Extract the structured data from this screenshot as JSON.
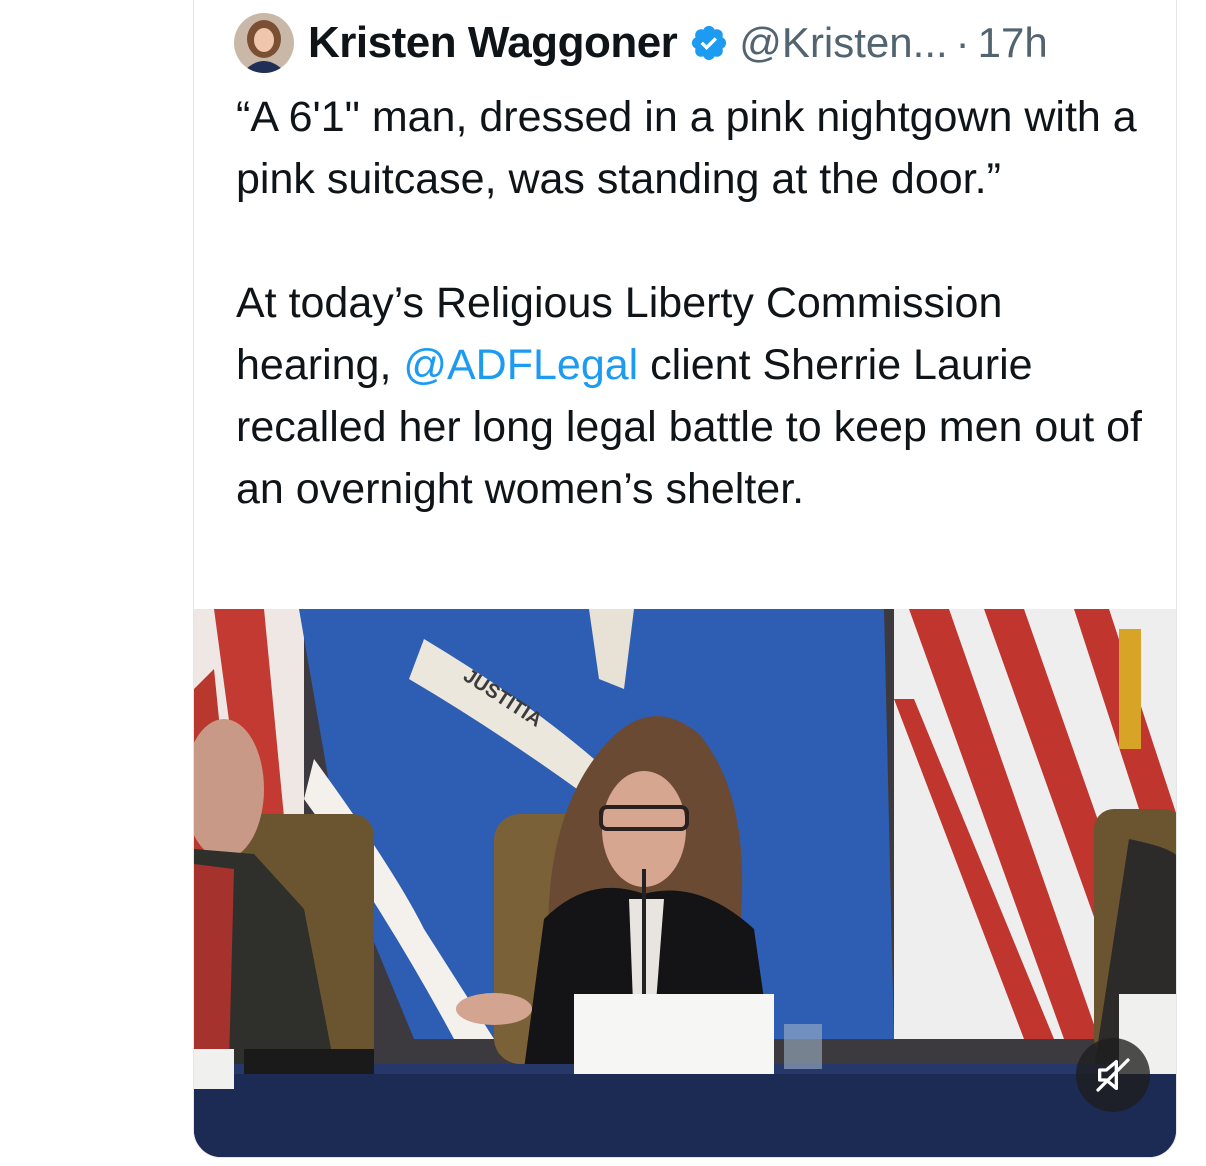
{
  "tweet": {
    "author_name": "Kristen Waggoner",
    "handle": "@Kristen...",
    "separator": "·",
    "time": "17h",
    "text_p1": "“A 6'1\" man, dressed in a pink nightgown with a pink suitcase, was standing at the door.”",
    "text_p2_before": "At today’s Religious Liberty Commission hearing, ",
    "text_p2_mention": "@ADFLegal",
    "text_p2_after": " client Sherrie Laurie recalled her long legal battle to keep men out of an overnight women’s shelter."
  },
  "media": {
    "flag_banner_text": "JUSTITIA",
    "mute_icon": "speaker-muted-icon"
  },
  "colors": {
    "verified_blue": "#1d9bf0",
    "link_blue": "#1d9bf0",
    "text_primary": "#0f1419",
    "text_secondary": "#536471"
  }
}
